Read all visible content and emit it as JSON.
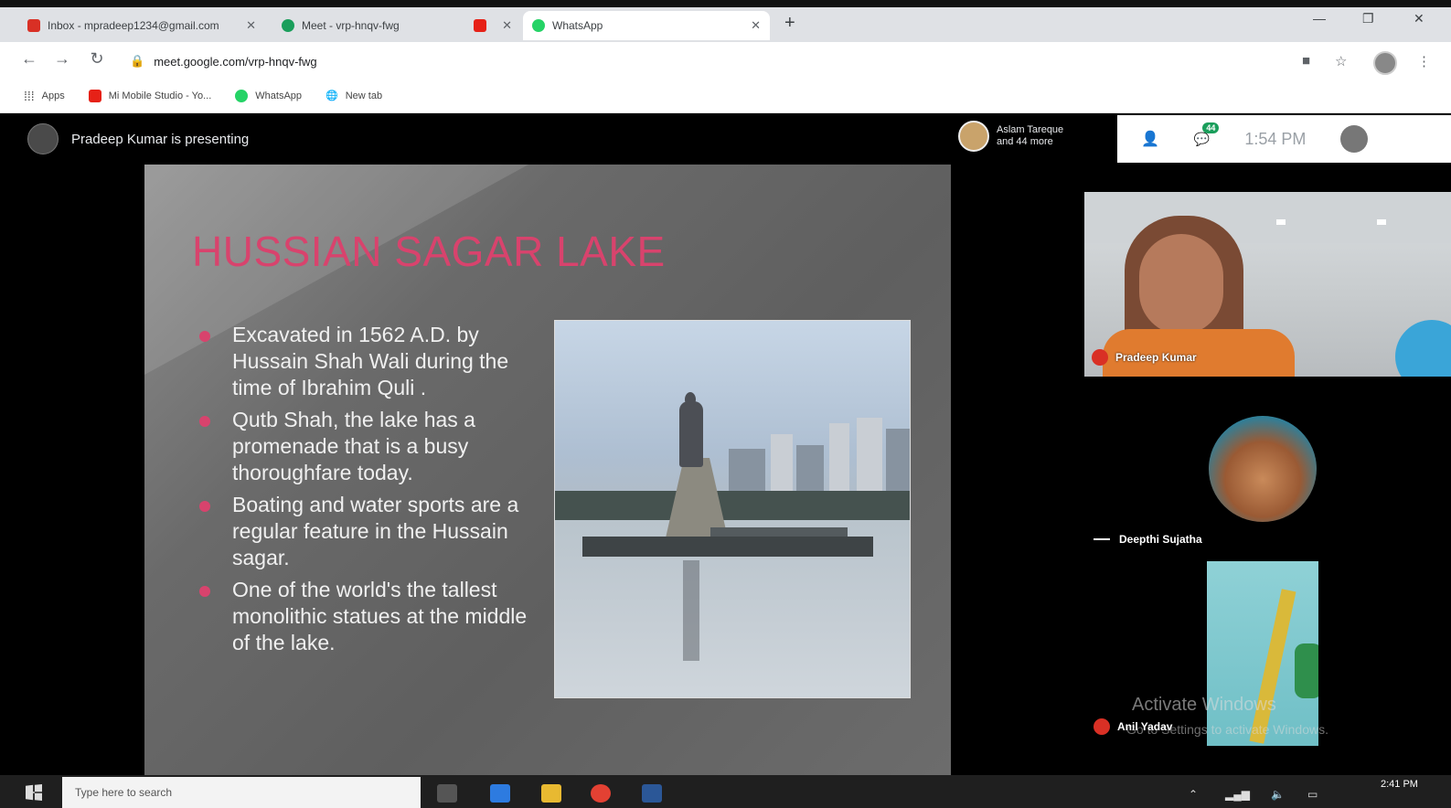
{
  "browser": {
    "tabs": [
      {
        "label": "Inbox - mpradeep1234@gmail.com",
        "icon": "gmail-icon",
        "active": false
      },
      {
        "label": "Meet - vrp-hnqv-fwg",
        "icon": "meet-icon",
        "active": false
      },
      {
        "label": "",
        "icon": "youtube-icon",
        "active": false
      },
      {
        "label": "WhatsApp",
        "icon": "whatsapp-icon",
        "active": true
      }
    ],
    "url": "meet.google.com/vrp-hnqv-fwg",
    "bookmarks": [
      {
        "label": "Apps",
        "icon": "apps-icon"
      },
      {
        "label": "Mi Mobile Studio - Yo...",
        "icon": "youtube-icon"
      },
      {
        "label": "WhatsApp",
        "icon": "whatsapp-icon"
      },
      {
        "label": "New tab",
        "icon": "globe-icon"
      }
    ]
  },
  "meet": {
    "presenter_text": "Pradeep Kumar is presenting",
    "participant_chip": {
      "line1": "Aslam Tareque",
      "line2": "and 44 more"
    },
    "participant_count": "44",
    "clock": "1:54 PM"
  },
  "slide": {
    "title": "HUSSIAN SAGAR LAKE",
    "bullets": [
      "Excavated in 1562 A.D. by Hussain Shah Wali during the time of Ibrahim Quli .",
      "Qutb Shah, the lake has a promenade that is a busy thoroughfare today.",
      "Boating and water sports are a regular feature in the Hussain sagar.",
      "One of the world's the tallest monolithic statues at the middle of the lake."
    ]
  },
  "participants": [
    {
      "name": "Pradeep Kumar",
      "muted": true
    },
    {
      "name": "Deepthi Sujatha",
      "muted": false
    },
    {
      "name": "Anil Yadav",
      "muted": true
    }
  ],
  "watermark": {
    "line1": "Activate Windows",
    "line2": "Go to Settings to activate Windows."
  },
  "taskbar": {
    "search_placeholder": "Type here to search",
    "time": "2:41 PM"
  },
  "colors": {
    "slide_accent": "#d8436d",
    "slide_bg": "#6b6b6b",
    "meet_bg": "#000000"
  }
}
